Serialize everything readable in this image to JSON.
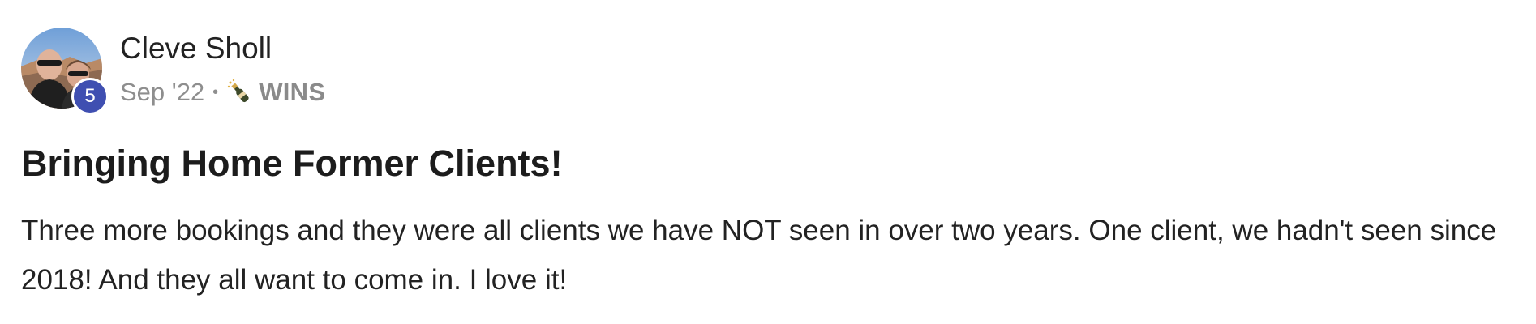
{
  "post": {
    "author": {
      "name": "Cleve Sholl",
      "level": "5",
      "avatar_icon": "user-photo-avatar"
    },
    "meta": {
      "date": "Sep '22",
      "separator": "•",
      "category_icon": "champagne-bottle-icon",
      "category": "WINS"
    },
    "title": "Bringing Home Former Clients!",
    "body": "Three more bookings and they were all clients we have NOT seen in over two years. One client, we hadn't seen since 2018! And they all want to come in. I love it!"
  },
  "colors": {
    "badge": "#3f4fb1",
    "meta_text": "#8e8e8e",
    "title_text": "#1c1c1c"
  }
}
